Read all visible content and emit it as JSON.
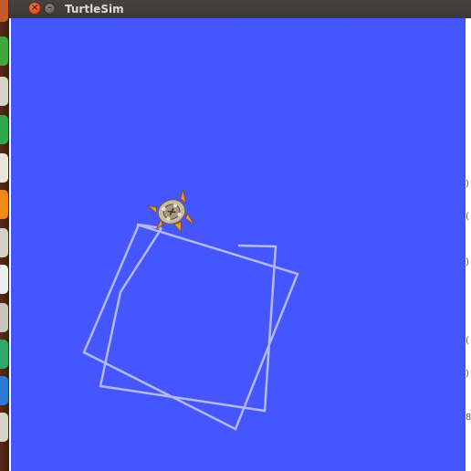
{
  "window": {
    "title": "TurtleSim",
    "close_glyph": "×",
    "minimize_glyph": "–",
    "background_color": "#4556ff",
    "pen_color": "#b3b8ff"
  },
  "launcher": {
    "items": [
      "launcher-app-1",
      "launcher-app-2",
      "launcher-app-3",
      "launcher-app-4",
      "launcher-app-5",
      "launcher-app-6",
      "launcher-app-7",
      "launcher-app-8",
      "launcher-app-9",
      "launcher-app-10",
      "launcher-app-11",
      "launcher-app-12"
    ]
  },
  "turtle": {
    "icon": "turtle-icon"
  },
  "right_edge": {
    "fragments": [
      ")",
      "(",
      ")",
      "(",
      ")",
      "8"
    ]
  }
}
